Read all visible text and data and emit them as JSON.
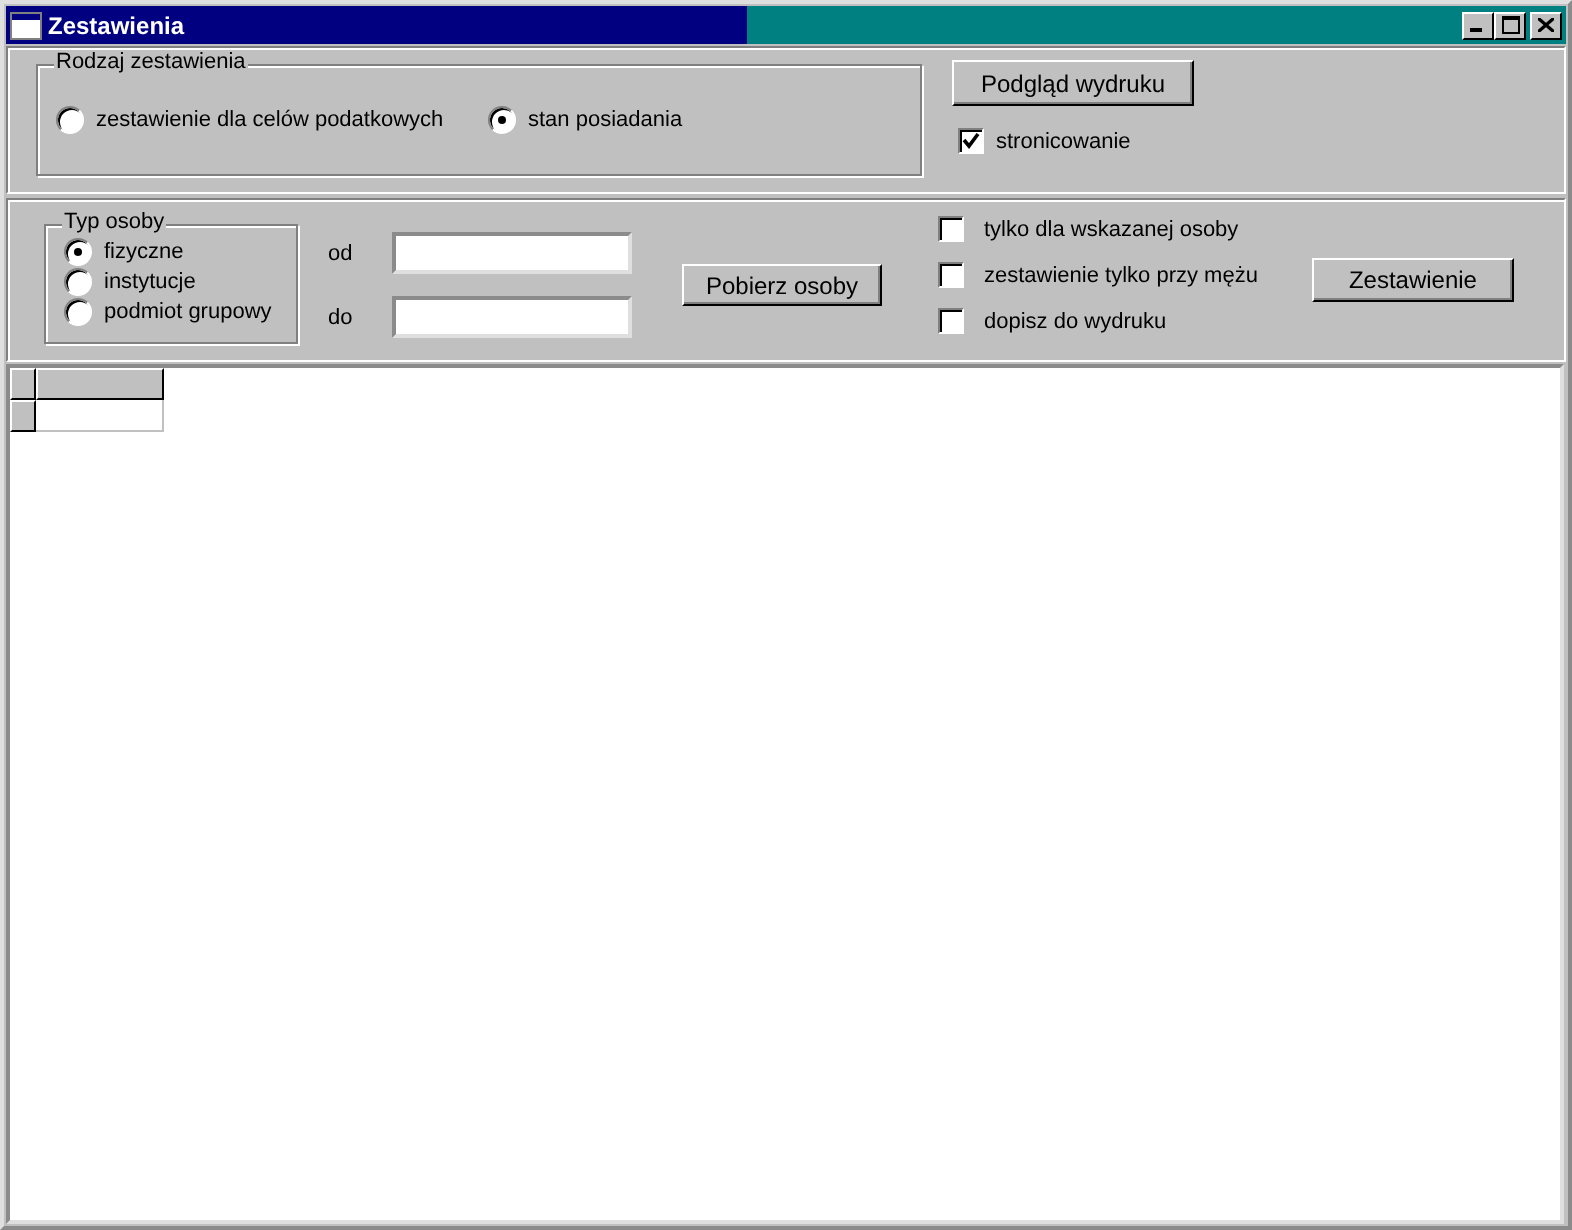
{
  "window": {
    "title": "Zestawienia"
  },
  "report_type": {
    "legend": "Rodzaj zestawienia",
    "options": [
      {
        "label": "zestawienie dla celów podatkowych",
        "selected": false
      },
      {
        "label": "stan posiadania",
        "selected": true
      }
    ]
  },
  "print_preview_button": "Podgląd wydruku",
  "pagination": {
    "label": "stronicowanie",
    "checked": true
  },
  "person_type": {
    "legend": "Typ osoby",
    "options": [
      {
        "label": "fizyczne",
        "selected": true
      },
      {
        "label": "instytucje",
        "selected": false
      },
      {
        "label": "podmiot grupowy",
        "selected": false
      }
    ]
  },
  "range": {
    "from_label": "od",
    "to_label": "do"
  },
  "fetch_button": "Pobierz osoby",
  "filters": [
    {
      "label": "tylko dla wskazanej osoby",
      "checked": false
    },
    {
      "label": "zestawienie tylko przy mężu",
      "checked": false
    },
    {
      "label": "dopisz do wydruku",
      "checked": false
    }
  ],
  "report_button": "Zestawienie"
}
